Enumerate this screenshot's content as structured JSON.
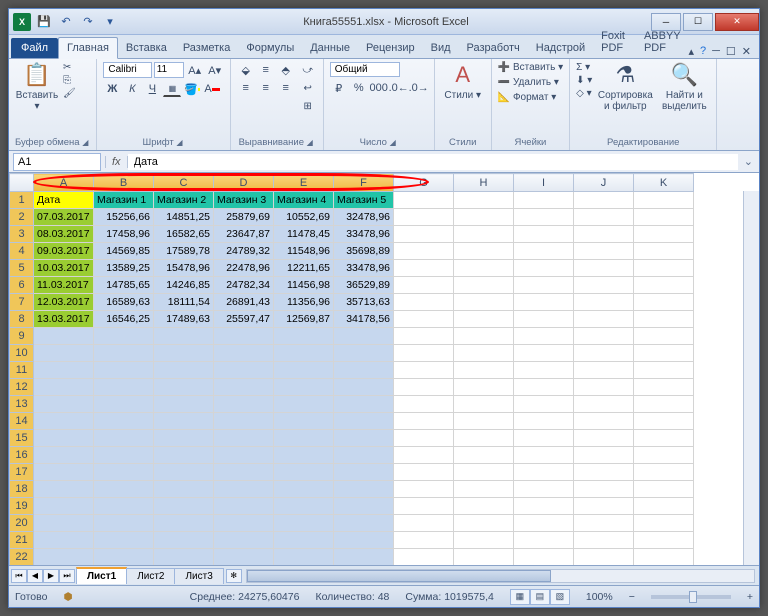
{
  "title": "Книга55551.xlsx - Microsoft Excel",
  "tabs": {
    "file": "Файл",
    "list": [
      "Главная",
      "Вставка",
      "Разметка",
      "Формулы",
      "Данные",
      "Рецензир",
      "Вид",
      "Разработч",
      "Надстрой",
      "Foxit PDF",
      "ABBYY PDF"
    ],
    "active": 0
  },
  "ribbon": {
    "clipboard": {
      "label": "Буфер обмена",
      "paste": "Вставить"
    },
    "font": {
      "label": "Шрифт",
      "name": "Calibri",
      "size": "11"
    },
    "align": {
      "label": "Выравнивание"
    },
    "number": {
      "label": "Число",
      "format": "Общий"
    },
    "styles": {
      "label": "Стили",
      "btn": "Стили"
    },
    "cells": {
      "label": "Ячейки",
      "insert": "Вставить",
      "delete": "Удалить",
      "format": "Формат"
    },
    "editing": {
      "label": "Редактирование",
      "sort": "Сортировка и фильтр",
      "find": "Найти и выделить"
    }
  },
  "namebox": "A1",
  "formula": "Дата",
  "columns": [
    "A",
    "B",
    "C",
    "D",
    "E",
    "F",
    "G",
    "H",
    "I",
    "J",
    "K"
  ],
  "sel_cols": 6,
  "headers": [
    "Дата",
    "Магазин 1",
    "Магазин 2",
    "Магазин 3",
    "Магазин 4",
    "Магазин 5"
  ],
  "rows": [
    {
      "r": 2,
      "date": "07.03.2017",
      "v": [
        "15256,66",
        "14851,25",
        "25879,69",
        "10552,69",
        "32478,96"
      ]
    },
    {
      "r": 3,
      "date": "08.03.2017",
      "v": [
        "17458,96",
        "16582,65",
        "23647,87",
        "11478,45",
        "33478,96"
      ]
    },
    {
      "r": 4,
      "date": "09.03.2017",
      "v": [
        "14569,85",
        "17589,78",
        "24789,32",
        "11548,96",
        "35698,89"
      ]
    },
    {
      "r": 5,
      "date": "10.03.2017",
      "v": [
        "13589,25",
        "15478,96",
        "22478,96",
        "12211,65",
        "33478,96"
      ]
    },
    {
      "r": 6,
      "date": "11.03.2017",
      "v": [
        "14785,65",
        "14246,85",
        "24782,34",
        "11456,98",
        "36529,89"
      ]
    },
    {
      "r": 7,
      "date": "12.03.2017",
      "v": [
        "16589,63",
        "18111,54",
        "26891,43",
        "11356,96",
        "35713,63"
      ]
    },
    {
      "r": 8,
      "date": "13.03.2017",
      "v": [
        "16546,25",
        "17489,63",
        "25597,47",
        "12569,87",
        "34178,56"
      ]
    }
  ],
  "empty_rows": [
    9,
    10,
    11,
    12,
    13,
    14,
    15,
    16,
    17,
    18,
    19,
    20,
    21,
    22
  ],
  "sheets": [
    "Лист1",
    "Лист2",
    "Лист3"
  ],
  "status": {
    "ready": "Готово",
    "avg_label": "Среднее:",
    "avg": "24275,60476",
    "count_label": "Количество:",
    "count": "48",
    "sum_label": "Сумма:",
    "sum": "1019575,4",
    "zoom": "100%"
  }
}
